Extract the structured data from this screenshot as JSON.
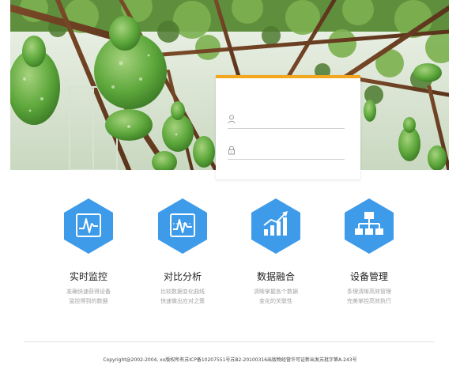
{
  "login": {
    "username_placeholder": "",
    "password_placeholder": ""
  },
  "features": [
    {
      "title": "实时监控",
      "desc_line1": "准确快速获得设备",
      "desc_line2": "监控得到的数据",
      "icon": "monitor-chart-icon"
    },
    {
      "title": "对比分析",
      "desc_line1": "比较数据变化曲线",
      "desc_line2": "快速做出应对之策",
      "icon": "compare-chart-icon"
    },
    {
      "title": "数据融合",
      "desc_line1": "清晰掌握各个数据",
      "desc_line2": "变化的关联性",
      "icon": "bar-growth-icon"
    },
    {
      "title": "设备管理",
      "desc_line1": "条理清晰高效管理",
      "desc_line2": "完美掌控高效执行",
      "icon": "org-tree-icon"
    }
  ],
  "footer": {
    "copyright": "Copyright@2002-2004, xx版权所有苏ICP备10207551号苏B2-20100316出版物经营许可证新出发苏批字第A-243号"
  },
  "colors": {
    "accent_orange": "#f2a71f",
    "hex_blue": "#3d9be9",
    "gourd_green": "#6fb84c"
  }
}
